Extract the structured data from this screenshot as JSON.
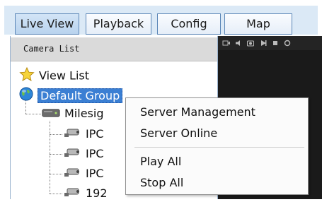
{
  "tabs": [
    {
      "label": "Live View",
      "active": true
    },
    {
      "label": "Playback",
      "active": false
    },
    {
      "label": "Config",
      "active": false
    },
    {
      "label": "Map",
      "active": false
    }
  ],
  "panel": {
    "title": "Camera List"
  },
  "tree": {
    "view_list": "View List",
    "default_group": "Default Group",
    "server": "Milesig",
    "cameras": [
      "IPC",
      "IPC",
      "IPC",
      "192"
    ]
  },
  "context_menu": {
    "items": [
      "Server Management",
      "Server Online",
      "Play All",
      "Stop All"
    ]
  },
  "colors": {
    "selection": "#3b7fd3",
    "tab_border": "#5b86b7",
    "video_background": "#1a1a1a"
  },
  "icons": {
    "view_list": "star-icon",
    "default_group": "globe-icon",
    "server": "server-icon",
    "camera": "camera-icon"
  }
}
